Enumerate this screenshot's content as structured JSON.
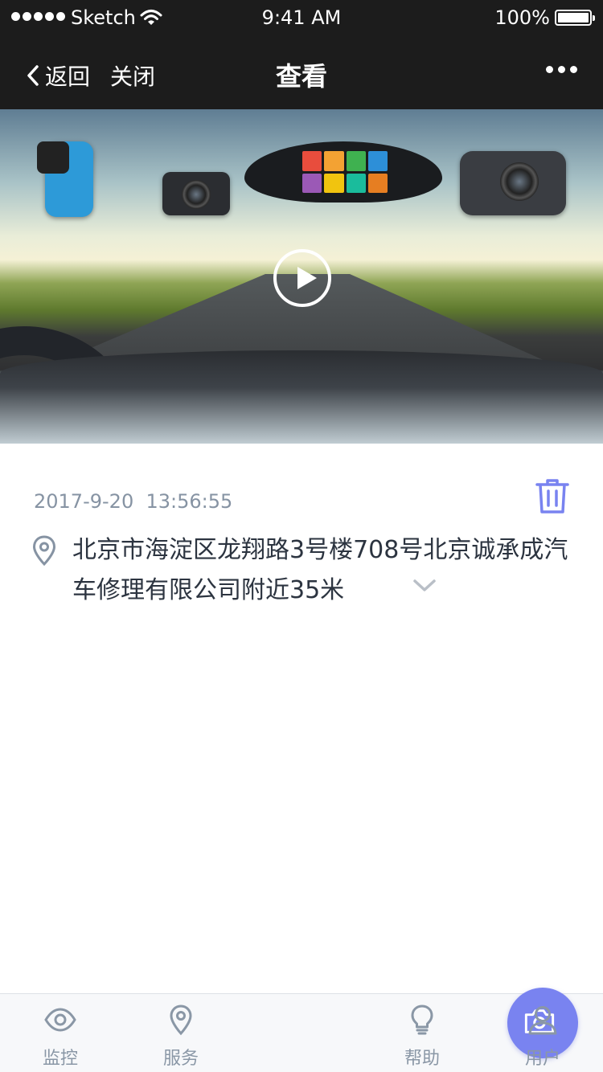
{
  "status_bar": {
    "carrier": "Sketch",
    "time": "9:41 AM",
    "battery": "100%"
  },
  "nav": {
    "back_label": "返回",
    "close_label": "关闭",
    "title": "查看"
  },
  "record": {
    "datetime": "2017-9-20  13:56:55",
    "address": "北京市海淀区龙翔路3号楼708号北京诚承成汽车修理有限公司附近35米"
  },
  "tabbar": {
    "items": [
      {
        "label": "监控",
        "icon": "eye-icon"
      },
      {
        "label": "服务",
        "icon": "location-pin-icon"
      },
      {
        "label": "",
        "icon": "camera-icon"
      },
      {
        "label": "帮助",
        "icon": "lightbulb-icon"
      },
      {
        "label": "用户",
        "icon": "user-icon"
      }
    ]
  },
  "colors": {
    "nav_bg": "#1c1c1c",
    "accent": "#7983f0",
    "muted_text": "#8693a3",
    "tab_icon": "#8a97a6"
  }
}
